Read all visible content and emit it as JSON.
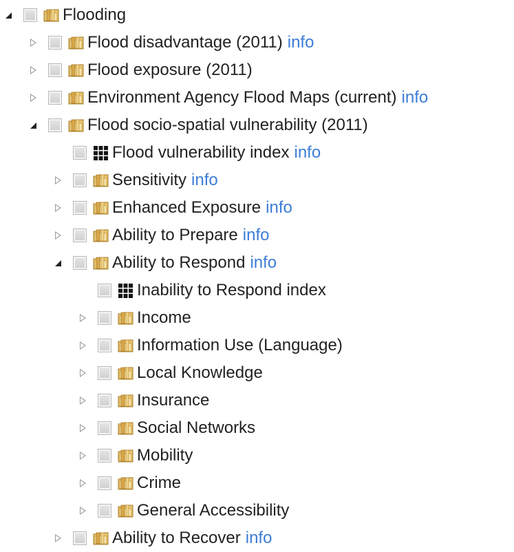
{
  "tree": {
    "info_label": "info",
    "rows": [
      {
        "label": "Flooding",
        "depth": 0,
        "toggle": "expanded",
        "icon": "folder-icon",
        "info": false
      },
      {
        "label": "Flood disadvantage (2011)",
        "depth": 1,
        "toggle": "collapsed",
        "icon": "folder-icon",
        "info": true
      },
      {
        "label": "Flood exposure (2011)",
        "depth": 1,
        "toggle": "collapsed",
        "icon": "folder-icon",
        "info": false
      },
      {
        "label": "Environment Agency Flood Maps (current)",
        "depth": 1,
        "toggle": "collapsed",
        "icon": "folder-icon",
        "info": true
      },
      {
        "label": "Flood socio-spatial vulnerability (2011)",
        "depth": 1,
        "toggle": "expanded",
        "icon": "folder-icon",
        "info": false
      },
      {
        "label": "Flood vulnerability index",
        "depth": 2,
        "toggle": "none",
        "icon": "grid-layer-icon",
        "info": true
      },
      {
        "label": "Sensitivity",
        "depth": 2,
        "toggle": "collapsed",
        "icon": "folder-icon",
        "info": true
      },
      {
        "label": "Enhanced Exposure",
        "depth": 2,
        "toggle": "collapsed",
        "icon": "folder-icon",
        "info": true
      },
      {
        "label": "Ability to Prepare",
        "depth": 2,
        "toggle": "collapsed",
        "icon": "folder-icon",
        "info": true
      },
      {
        "label": "Ability to Respond",
        "depth": 2,
        "toggle": "expanded",
        "icon": "folder-icon",
        "info": true
      },
      {
        "label": "Inability to Respond index",
        "depth": 3,
        "toggle": "none",
        "icon": "grid-layer-icon",
        "info": false
      },
      {
        "label": "Income",
        "depth": 3,
        "toggle": "collapsed",
        "icon": "folder-icon",
        "info": false
      },
      {
        "label": "Information Use (Language)",
        "depth": 3,
        "toggle": "collapsed",
        "icon": "folder-icon",
        "info": false
      },
      {
        "label": "Local Knowledge",
        "depth": 3,
        "toggle": "collapsed",
        "icon": "folder-icon",
        "info": false
      },
      {
        "label": "Insurance",
        "depth": 3,
        "toggle": "collapsed",
        "icon": "folder-icon",
        "info": false
      },
      {
        "label": "Social Networks",
        "depth": 3,
        "toggle": "collapsed",
        "icon": "folder-icon",
        "info": false
      },
      {
        "label": "Mobility",
        "depth": 3,
        "toggle": "collapsed",
        "icon": "folder-icon",
        "info": false
      },
      {
        "label": "Crime",
        "depth": 3,
        "toggle": "collapsed",
        "icon": "folder-icon",
        "info": false
      },
      {
        "label": "General Accessibility",
        "depth": 3,
        "toggle": "collapsed",
        "icon": "folder-icon",
        "info": false
      },
      {
        "label": "Ability to Recover",
        "depth": 2,
        "toggle": "collapsed",
        "icon": "folder-icon",
        "info": true
      }
    ]
  },
  "colors": {
    "text": "#222222",
    "info_link": "#3c7dd8",
    "folder": "#d8aa4a",
    "checkbox_border": "#b9b9b9"
  }
}
